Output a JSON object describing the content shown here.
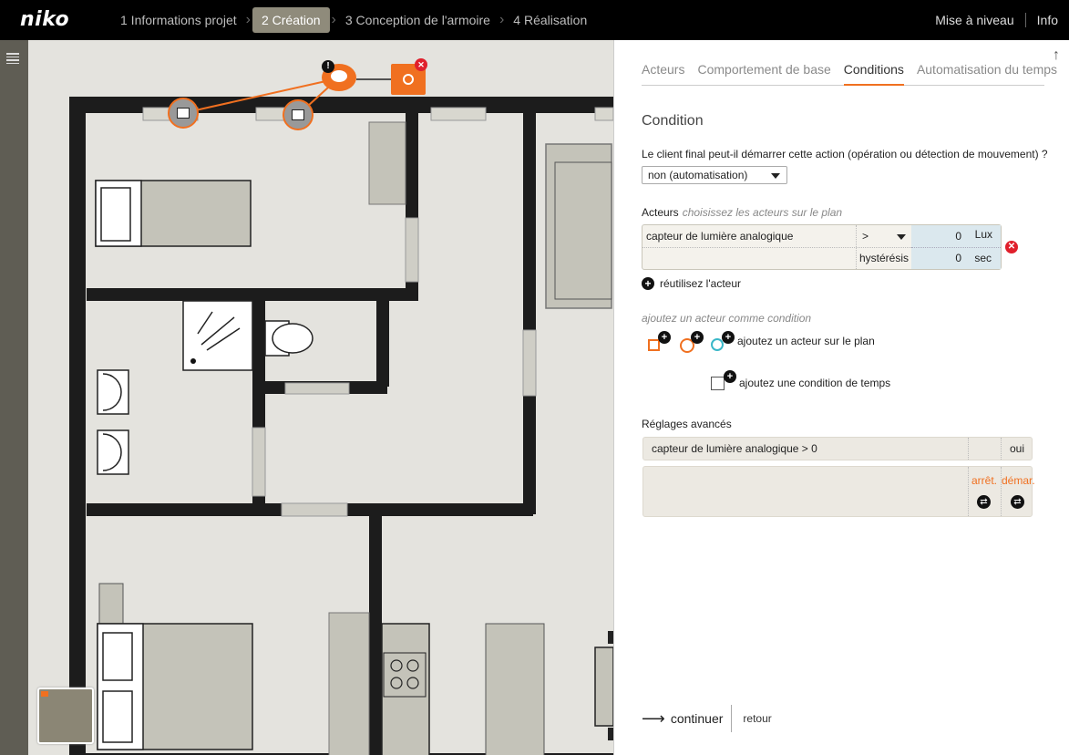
{
  "app": {
    "logo": "niko"
  },
  "steps": [
    {
      "label": "1 Informations projet",
      "active": false
    },
    {
      "label": "2 Création",
      "active": true
    },
    {
      "label": "3 Conception de l'armoire",
      "active": false
    },
    {
      "label": "4 Réalisation",
      "active": false
    }
  ],
  "top_right": {
    "upgrade": "Mise à niveau",
    "info": "Info"
  },
  "tabs": [
    {
      "label": "Acteurs",
      "active": false
    },
    {
      "label": "Comportement de base",
      "active": false
    },
    {
      "label": "Conditions",
      "active": true
    },
    {
      "label": "Automatisation du temps",
      "active": false
    }
  ],
  "condition": {
    "title": "Condition",
    "question": "Le client final peut-il démarrer cette action (opération ou détection de mouvement) ?",
    "select_value": "non (automatisation)",
    "acteurs_label": "Acteurs",
    "acteurs_hint": "choisissez les acteurs sur le plan",
    "actor": {
      "name": "capteur de lumière analogique",
      "operator": ">",
      "value": "0",
      "unit": "Lux",
      "hysteresis_label": "hystérésis",
      "hysteresis_value": "0",
      "hysteresis_unit": "sec"
    },
    "reuse_label": "réutilisez l'acteur",
    "add_actor_hint": "ajoutez un acteur comme condition",
    "add_actor_plan": "ajoutez un acteur sur le plan",
    "add_time_condition": "ajoutez une condition de temps"
  },
  "advanced": {
    "label": "Réglages avancés",
    "row_text": "capteur de lumière analogique > 0",
    "row_value": "oui",
    "stop_label": "arrêt.",
    "start_label": "démar."
  },
  "footer": {
    "continue": "continuer",
    "back": "retour"
  },
  "icons": {
    "remove": "✕",
    "plus": "+",
    "swap": "⇄",
    "arrow": "⟶",
    "scroll_up": "↑"
  },
  "colors": {
    "accent": "#f07020",
    "danger": "#e0202c",
    "active_step": "#8f8b7b"
  }
}
